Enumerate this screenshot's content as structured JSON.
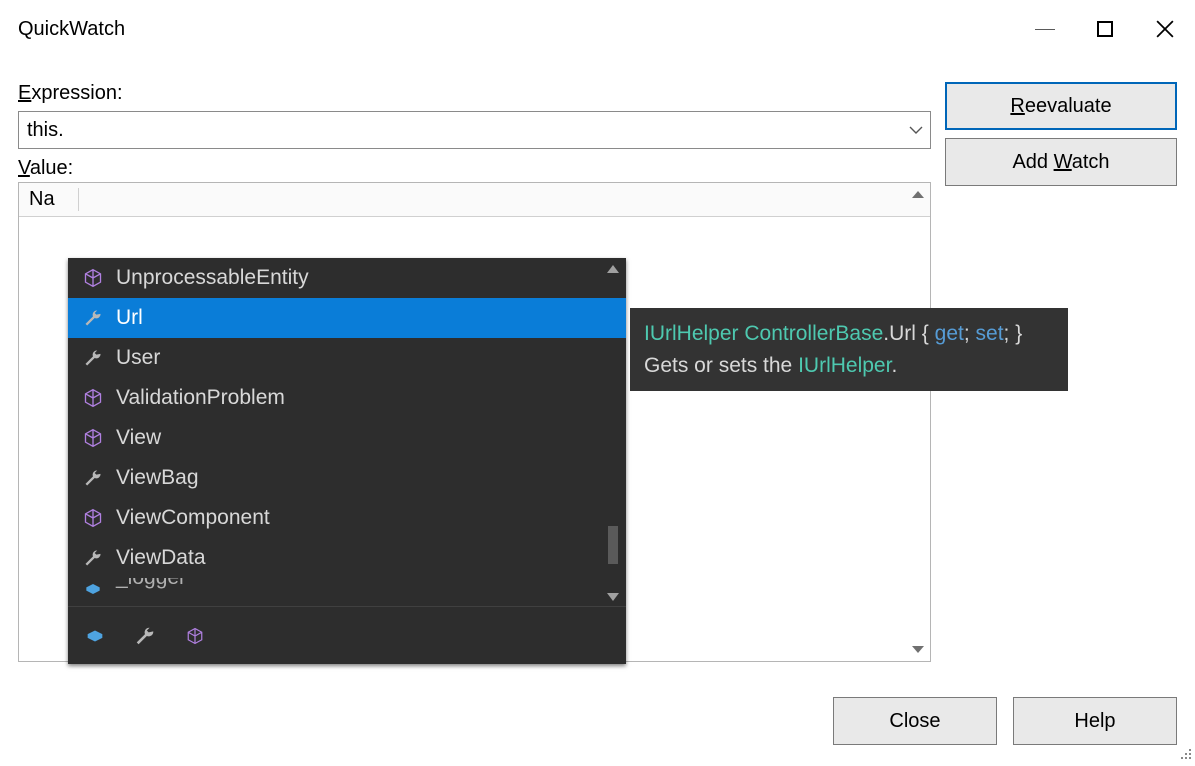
{
  "window": {
    "title": "QuickWatch"
  },
  "labels": {
    "expression_prefix": "E",
    "expression_rest": "xpression:",
    "value_prefix": "V",
    "value_rest": "alue:",
    "name_column": "Na"
  },
  "expression": {
    "value": "this."
  },
  "buttons": {
    "reevaluate_prefix": "R",
    "reevaluate_rest": "eevaluate",
    "addwatch_pre": "Add ",
    "addwatch_u": "W",
    "addwatch_post": "atch",
    "close": "Close",
    "help": "Help"
  },
  "intellisense": {
    "items": [
      {
        "icon": "cube",
        "label": "UnprocessableEntity",
        "selected": false
      },
      {
        "icon": "wrench",
        "label": "Url",
        "selected": true
      },
      {
        "icon": "wrench",
        "label": "User",
        "selected": false
      },
      {
        "icon": "cube",
        "label": "ValidationProblem",
        "selected": false
      },
      {
        "icon": "cube",
        "label": "View",
        "selected": false
      },
      {
        "icon": "wrench",
        "label": "ViewBag",
        "selected": false
      },
      {
        "icon": "cube",
        "label": "ViewComponent",
        "selected": false
      },
      {
        "icon": "wrench",
        "label": "ViewData",
        "selected": false
      },
      {
        "icon": "field",
        "label": "_logger",
        "selected": false
      }
    ]
  },
  "tooltip": {
    "type": "IUrlHelper",
    "class": "ControllerBase",
    "dot": ".",
    "member": "Url",
    "brace_open": " { ",
    "get": "get",
    "semi": "; ",
    "set": "set",
    "brace_close": "; }",
    "desc_pre": "Gets or sets the ",
    "desc_type": "IUrlHelper",
    "desc_post": "."
  }
}
